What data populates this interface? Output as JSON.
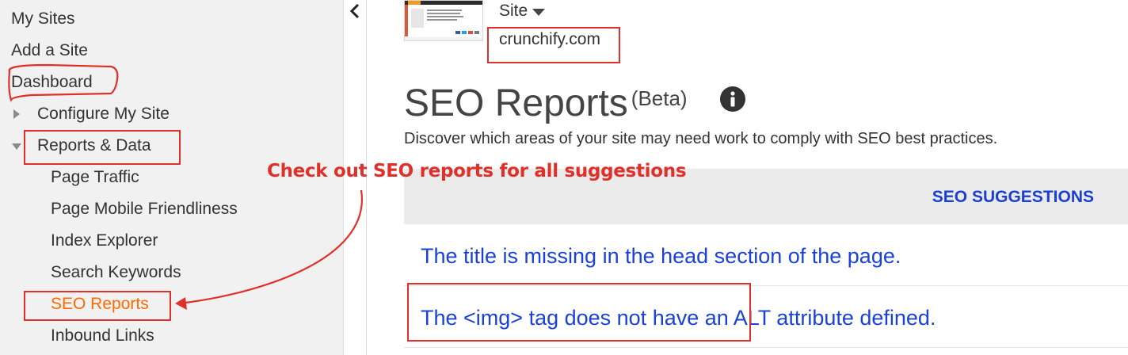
{
  "sidebar": {
    "items": [
      {
        "label": "My Sites"
      },
      {
        "label": "Add a Site"
      },
      {
        "label": "Dashboard"
      },
      {
        "label": "Configure My Site"
      },
      {
        "label": "Reports & Data"
      },
      {
        "label": "Page Traffic"
      },
      {
        "label": "Page Mobile Friendliness"
      },
      {
        "label": "Index Explorer"
      },
      {
        "label": "Search Keywords"
      },
      {
        "label": "SEO Reports"
      },
      {
        "label": "Inbound Links"
      }
    ],
    "active_item": "SEO Reports",
    "active_color": "#ff6a00"
  },
  "site": {
    "selector_label": "Site",
    "domain": "crunchify.com"
  },
  "page": {
    "title": "SEO Reports",
    "title_badge": "(Beta)",
    "description": "Discover which areas of your site may need work to comply with SEO best practices."
  },
  "table": {
    "header": "SEO SUGGESTIONS",
    "rows": [
      {
        "text": "The title is missing in the head section of the page."
      },
      {
        "text": "The <img> tag does not have an ALT attribute defined."
      }
    ],
    "link_color": "#1a42d6"
  },
  "annotation": {
    "callout": "Check out SEO reports for all suggestions",
    "color": "#e0302a"
  },
  "icons": [
    "chevron-left-icon",
    "caret-down-icon",
    "info-icon",
    "triangle-right-icon",
    "triangle-down-icon"
  ]
}
